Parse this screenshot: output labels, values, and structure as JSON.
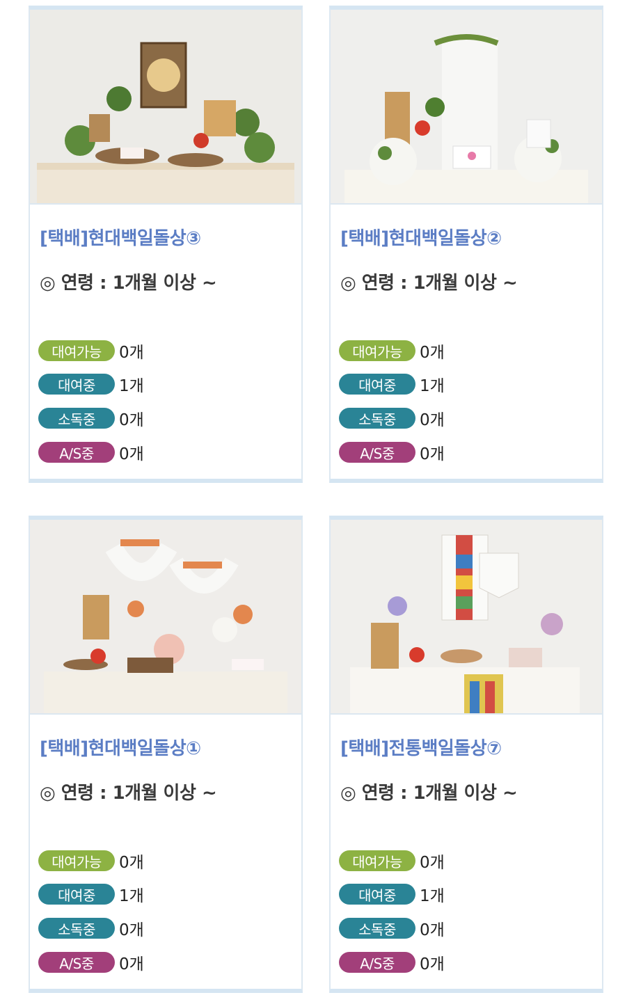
{
  "products": [
    {
      "title": "[택배]현대백일돌상③",
      "age": "◎ 연령 : 1개월 이상 ~",
      "image": "modern-100day-table-3-photo",
      "statuses": [
        {
          "label": "대여가능",
          "count": "0개"
        },
        {
          "label": "대여중",
          "count": "1개"
        },
        {
          "label": "소독중",
          "count": "0개"
        },
        {
          "label": "A/S중",
          "count": "0개"
        }
      ]
    },
    {
      "title": "[택배]현대백일돌상②",
      "age": "◎ 연령 : 1개월 이상 ~",
      "image": "modern-100day-table-2-photo",
      "statuses": [
        {
          "label": "대여가능",
          "count": "0개"
        },
        {
          "label": "대여중",
          "count": "1개"
        },
        {
          "label": "소독중",
          "count": "0개"
        },
        {
          "label": "A/S중",
          "count": "0개"
        }
      ]
    },
    {
      "title": "[택배]현대백일돌상①",
      "age": "◎ 연령 : 1개월 이상 ~",
      "image": "modern-100day-table-1-photo",
      "statuses": [
        {
          "label": "대여가능",
          "count": "0개"
        },
        {
          "label": "대여중",
          "count": "1개"
        },
        {
          "label": "소독중",
          "count": "0개"
        },
        {
          "label": "A/S중",
          "count": "0개"
        }
      ]
    },
    {
      "title": "[택배]전통백일돌상⑦",
      "age": "◎ 연령 : 1개월 이상 ~",
      "image": "traditional-100day-table-7-photo",
      "statuses": [
        {
          "label": "대여가능",
          "count": "0개"
        },
        {
          "label": "대여중",
          "count": "1개"
        },
        {
          "label": "소독중",
          "count": "0개"
        },
        {
          "label": "A/S중",
          "count": "0개"
        }
      ]
    }
  ],
  "colors": {
    "title": "#5b7dc4",
    "available": "#8db243",
    "renting": "#2a8496",
    "sanitizing": "#2a8496",
    "repair": "#a23f7a",
    "card_border": "#d5e5f2"
  }
}
